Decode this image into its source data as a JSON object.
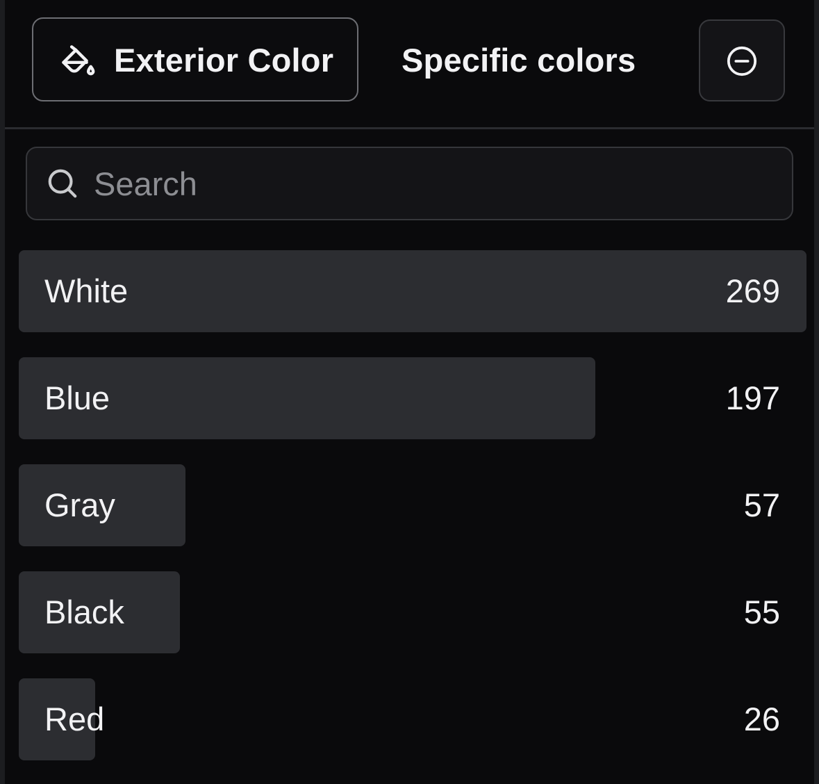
{
  "filter": {
    "chip_label": "Exterior Color",
    "chip_icon": "paint-bucket-icon",
    "mode_label": "Specific colors",
    "remove_icon": "minus-circle-icon"
  },
  "search": {
    "placeholder": "Search",
    "value": "",
    "icon": "search-icon"
  },
  "options": [
    {
      "label": "White",
      "count": "269",
      "value": 269
    },
    {
      "label": "Blue",
      "count": "197",
      "value": 197
    },
    {
      "label": "Gray",
      "count": "57",
      "value": 57
    },
    {
      "label": "Black",
      "count": "55",
      "value": 55
    },
    {
      "label": "Red",
      "count": "26",
      "value": 26
    }
  ],
  "colors": {
    "background": "#0a0a0c",
    "bar": "#2c2d31",
    "text": "#f2f2f4",
    "muted": "#8d8e93"
  }
}
